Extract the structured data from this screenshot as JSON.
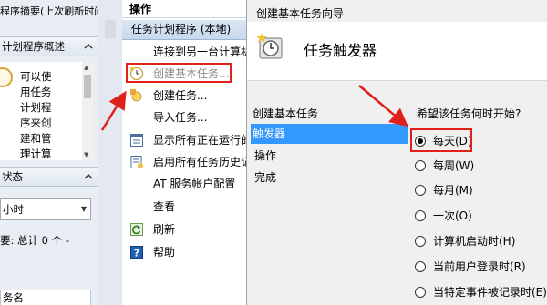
{
  "left_pane": {
    "title": "程序摘要(上次刷新时间",
    "overview_header": "计划程序概述",
    "overview_lines": [
      "可以使",
      "用任务",
      "计划程",
      "序来创",
      "建和管",
      "理计算"
    ],
    "status_header": "状态",
    "time_select": "小时",
    "summary_text": "要: 总计 0 个 -",
    "bottom_field": "务名"
  },
  "actions": {
    "header": "操作",
    "sub_header": "任务计划程序 (本地)",
    "items": [
      {
        "label": "连接到另一台计算机",
        "icon": "none",
        "disabled": false
      },
      {
        "label": "创建基本任务...",
        "icon": "clock-icon",
        "disabled": true
      },
      {
        "label": "创建任务...",
        "icon": "task-icon",
        "disabled": false
      },
      {
        "label": "导入任务...",
        "icon": "none",
        "disabled": false
      },
      {
        "label": "显示所有正在运行的任务",
        "icon": "list-icon",
        "disabled": false
      },
      {
        "label": "启用所有任务历史记录",
        "icon": "history-icon",
        "disabled": false
      },
      {
        "label": "AT 服务帐户配置",
        "icon": "none",
        "disabled": false
      },
      {
        "label": "查看",
        "icon": "none",
        "disabled": false
      },
      {
        "label": "刷新",
        "icon": "refresh-icon",
        "disabled": false
      },
      {
        "label": "帮助",
        "icon": "help-icon",
        "disabled": false
      }
    ]
  },
  "wizard": {
    "window_title": "创建基本任务向导",
    "header_title": "任务触发器",
    "nav_header": "创建基本任务",
    "nav_items": [
      {
        "label": "触发器",
        "selected": true
      },
      {
        "label": "操作",
        "selected": false
      },
      {
        "label": "完成",
        "selected": false
      }
    ],
    "question": "希望该任务何时开始?",
    "options": [
      {
        "label": "每天(D)",
        "checked": true
      },
      {
        "label": "每周(W)",
        "checked": false
      },
      {
        "label": "每月(M)",
        "checked": false
      },
      {
        "label": "一次(O)",
        "checked": false
      },
      {
        "label": "计算机启动时(H)",
        "checked": false
      },
      {
        "label": "当前用户登录时(R)",
        "checked": false
      },
      {
        "label": "当特定事件被记录时(E)",
        "checked": false
      }
    ]
  },
  "colors": {
    "highlight_red": "#e0201a",
    "selection_blue": "#3399ff"
  }
}
